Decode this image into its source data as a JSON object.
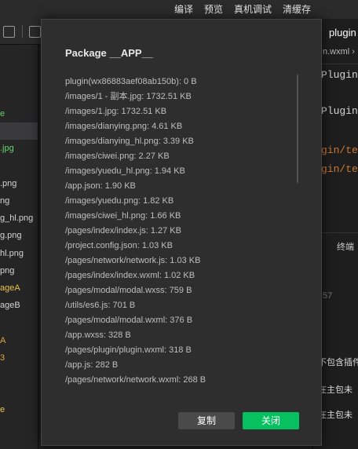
{
  "menu": [
    "编译",
    "预览",
    "真机调试",
    "清缓存"
  ],
  "left_files": [
    {
      "label": "e",
      "cls": "green"
    },
    {
      "label": "",
      "cls": "sel"
    },
    {
      "label": ".jpg",
      "cls": "green"
    },
    {
      "label": "",
      "cls": ""
    },
    {
      "label": ".png",
      "cls": ""
    },
    {
      "label": "ng",
      "cls": ""
    },
    {
      "label": "g_hl.png",
      "cls": ""
    },
    {
      "label": "g.png",
      "cls": ""
    },
    {
      "label": "hl.png",
      "cls": ""
    },
    {
      "label": "png",
      "cls": ""
    },
    {
      "label": "ageA",
      "cls": "yellow"
    },
    {
      "label": "ageB",
      "cls": ""
    },
    {
      "label": "",
      "cls": ""
    },
    {
      "label": "A",
      "cls": "orange"
    },
    {
      "label": "3",
      "cls": "orange"
    },
    {
      "label": "",
      "cls": ""
    },
    {
      "label": "",
      "cls": ""
    },
    {
      "label": "e",
      "cls": "yellow"
    }
  ],
  "right": {
    "tab": "plugin",
    "crumb": "n.wxml ›",
    "code1": "Plugin",
    "code2": "Plugin",
    "code3": "gin/test",
    "code4": "gin/test",
    "panel_head": "终端",
    "num": "57",
    "msg1": "不包含插件",
    "msg2": "在主包未",
    "msg3": "在主包未"
  },
  "dialog": {
    "title": "Package __APP__",
    "files": [
      "plugin(wx86883aef08ab150b): 0 B",
      "/images/1 - 副本.jpg: 1732.51 KB",
      "/images/1.jpg: 1732.51 KB",
      "/images/dianying.png: 4.61 KB",
      "/images/dianying_hl.png: 3.39 KB",
      "/images/ciwei.png: 2.27 KB",
      "/images/yuedu_hl.png: 1.94 KB",
      "/app.json: 1.90 KB",
      "/images/yuedu.png: 1.82 KB",
      "/images/ciwei_hl.png: 1.66 KB",
      "/pages/index/index.js: 1.27 KB",
      "/project.config.json: 1.03 KB",
      "/pages/network/network.js: 1.03 KB",
      "/pages/index/index.wxml: 1.02 KB",
      "/pages/modal/modal.wxss: 759 B",
      "/utils/es6.js: 701 B",
      "/pages/modal/modal.wxml: 376 B",
      "/app.wxss: 328 B",
      "/pages/plugin/plugin.wxml: 318 B",
      "/app.js: 282 B",
      "/pages/network/network.wxml: 268 B"
    ],
    "copy_label": "复制",
    "close_label": "关闭"
  }
}
